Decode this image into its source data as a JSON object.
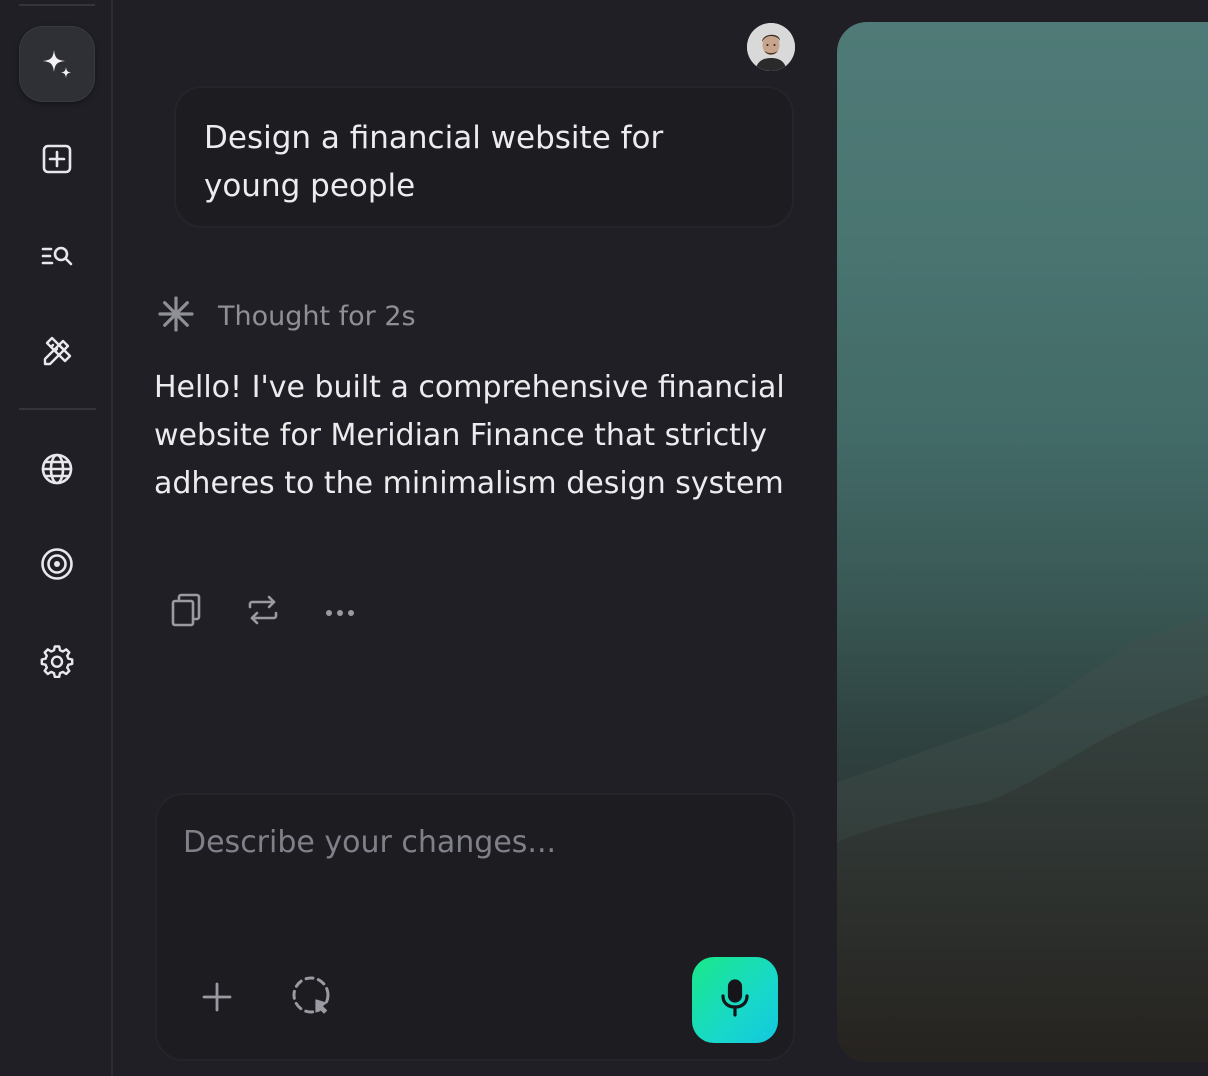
{
  "sidebar": {
    "items": [
      {
        "name": "sparkles-icon",
        "active": true
      },
      {
        "name": "new-project-icon"
      },
      {
        "name": "search-list-icon"
      },
      {
        "name": "design-tools-icon"
      },
      {
        "name": "globe-icon"
      },
      {
        "name": "target-icon"
      },
      {
        "name": "gear-icon"
      }
    ]
  },
  "chat": {
    "user_message": "Design a financial website for young people",
    "thought_label": "Thought for 2s",
    "assistant_message": "Hello! I've built a comprehensive financial website for Meridian Finance that strictly adheres to the minimalism design system",
    "actions": [
      "copy-icon",
      "regenerate-icon",
      "more-icon"
    ]
  },
  "composer": {
    "placeholder": "Describe your changes...",
    "value": ""
  },
  "colors": {
    "background": "#1f1f25",
    "accent_gradient_start": "#19e887",
    "accent_gradient_end": "#12c8e0"
  }
}
